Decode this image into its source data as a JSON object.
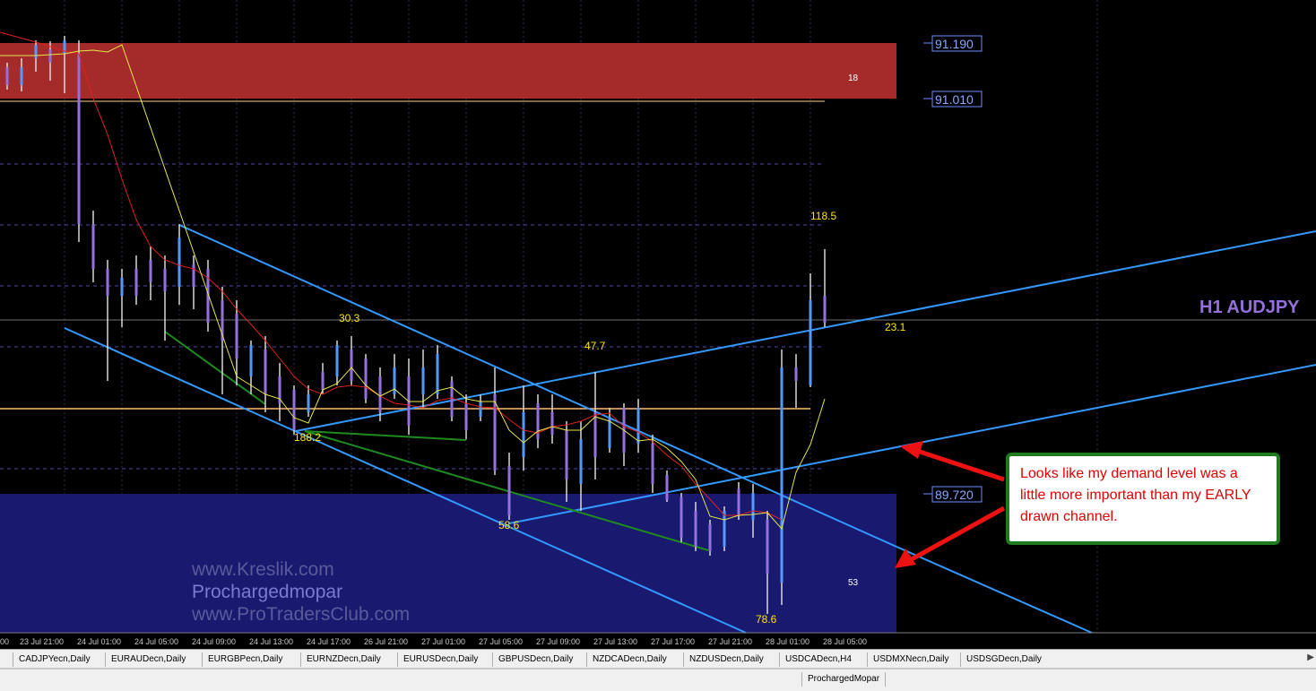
{
  "chart": {
    "symbol_label": "H1 AUDJPY",
    "price_labels": [
      "91.190",
      "91.010",
      "89.720"
    ],
    "zone_labels": {
      "supply": "18",
      "demand": "53"
    },
    "value_labels": [
      "118.5",
      "23.1",
      "30.3",
      "47.7",
      "188.2",
      "58.6",
      "78.6"
    ],
    "watermark": [
      "www.Kreslik.com",
      "Prochargedmopar",
      "www.ProTradersClub.com"
    ],
    "time_labels": [
      "00",
      "23 Jul 21:00",
      "24 Jul 01:00",
      "24 Jul 05:00",
      "24 Jul 09:00",
      "24 Jul 13:00",
      "24 Jul 17:00",
      "26 Jul 21:00",
      "27 Jul 01:00",
      "27 Jul 05:00",
      "27 Jul 09:00",
      "27 Jul 13:00",
      "27 Jul 17:00",
      "27 Jul 21:00",
      "28 Jul 01:00",
      "28 Jul 05:00"
    ],
    "colors": {
      "supply_zone": "#a52a2a",
      "demand_zone": "#191970",
      "trendline": "#3399ff",
      "bull_candle": "#5599ff",
      "bear_candle": "#9370db",
      "price_box": "#6a8cff"
    }
  },
  "callout": {
    "text": "Looks like my demand level was a little more important than my EARLY drawn channel."
  },
  "tabs": [
    "CADJPYecn,Daily",
    "EURAUDecn,Daily",
    "EURGBPecn,Daily",
    "EURNZDecn,Daily",
    "EURUSDecn,Daily",
    "GBPUSDecn,Daily",
    "NZDCADecn,Daily",
    "NZDUSDecn,Daily",
    "USDCADecn,H4",
    "USDMXNecn,Daily",
    "USDSGDecn,Daily"
  ],
  "status": {
    "profile": "ProchargedMopar"
  }
}
